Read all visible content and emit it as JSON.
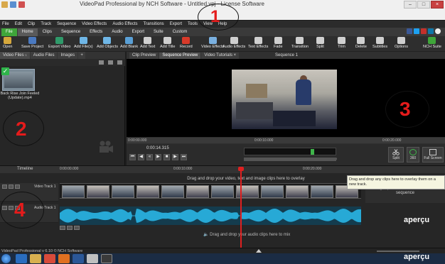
{
  "window": {
    "title": "VideoPad Professional by NCH Software - Untitled.vpj - License Software"
  },
  "menu": [
    "File",
    "Edit",
    "Clip",
    "Track",
    "Sequence",
    "Video Effects",
    "Audio Effects",
    "Transitions",
    "Export",
    "Tools",
    "View",
    "Help"
  ],
  "ribbon_tabs": [
    "File",
    "Home",
    "Clips",
    "Sequence",
    "Effects",
    "Audio",
    "Export",
    "Suite",
    "Custom"
  ],
  "toolbar": [
    {
      "label": "Open",
      "icon": "folder-icon",
      "color": "#d6a83c"
    },
    {
      "label": "Save Project",
      "icon": "save-icon",
      "color": "#4a79c0"
    },
    {
      "label": "Export Video",
      "icon": "export-icon",
      "color": "#2f9a6a"
    },
    {
      "label": "Add File(s)",
      "icon": "add-file-icon",
      "color": "#6fb6e6"
    },
    {
      "label": "Add Objects",
      "icon": "add-objects-icon",
      "color": "#6fb6e6"
    },
    {
      "label": "Add Blank",
      "icon": "add-blank-icon",
      "color": "#5aa0d6"
    },
    {
      "label": "Add Text",
      "icon": "text-icon",
      "color": "#d0d0d0"
    },
    {
      "label": "Add Title",
      "icon": "title-icon",
      "color": "#d0d0d0"
    },
    {
      "label": "Record",
      "icon": "record-icon",
      "color": "#d83a2a"
    },
    {
      "label": "Video Effects",
      "icon": "video-effects-icon",
      "color": "#7ab0e0"
    },
    {
      "label": "Audio Effects",
      "icon": "audio-effects-icon",
      "color": "#d0d0d0"
    },
    {
      "label": "Text Effects",
      "icon": "text-effects-icon",
      "color": "#d0d0d0"
    },
    {
      "label": "Fade",
      "icon": "fade-icon",
      "color": "#d0d0d0"
    },
    {
      "label": "Transition",
      "icon": "transition-icon",
      "color": "#d0d0d0"
    },
    {
      "label": "Split",
      "icon": "scissors-icon",
      "color": "#d0d0d0"
    },
    {
      "label": "Trim",
      "icon": "trim-icon",
      "color": "#d0d0d0"
    },
    {
      "label": "Delete",
      "icon": "delete-icon",
      "color": "#d0d0d0"
    },
    {
      "label": "Subtitles",
      "icon": "subtitles-icon",
      "color": "#d0d0d0"
    },
    {
      "label": "Options",
      "icon": "options-icon",
      "color": "#d0d0d0"
    },
    {
      "label": "NCH Suite",
      "icon": "nch-suite-icon",
      "color": "#3fa63a"
    }
  ],
  "bin": {
    "tabs": [
      "Video Files",
      "Audio Files",
      "Images"
    ],
    "video_files_count": "1",
    "clip_name": "Back Rise Join Feeled (Update).mp4"
  },
  "preview": {
    "tabs": [
      "Clip Preview",
      "Sequence Preview",
      "Video Tutorials"
    ],
    "title": "Sequence 1",
    "ruler": [
      "0:00:00.000",
      "0:00:10.000",
      "0:00:20.000"
    ],
    "current_time": "0:00:14.315",
    "meter_scale": [
      "-42",
      "-36",
      "-30",
      "-24",
      "-18",
      "-12",
      "-6",
      "0"
    ],
    "split_label": "Split",
    "three_sixty_label": "360",
    "fullscreen_label": "Full Screen"
  },
  "timeline": {
    "label": "Timeline",
    "ruler": [
      "0:00:00.000",
      "0:00:10.000",
      "0:00:20.000"
    ],
    "video_track": "Video Track 1",
    "audio_track": "Audio Track 1",
    "overlay_hint": "Drag and drop your video, text and image clips here to overlay",
    "add_hint": "Drag clip here to add to end of the sequence",
    "audio_hint": "Drag and drop your audio clips here to mix",
    "tooltip": "Drag and drop any clips here to overlay them on a new track."
  },
  "annotations": {
    "numbers": [
      "1",
      "2",
      "3",
      "4"
    ],
    "apercu": "aperçu"
  },
  "status": "VideoPad Professional v 6.10 © NCH Software"
}
